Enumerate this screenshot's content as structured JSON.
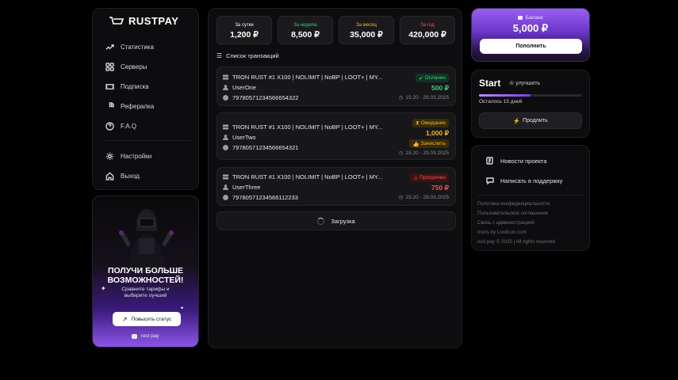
{
  "brand": {
    "name": "RUSTPAY"
  },
  "nav": {
    "items": [
      {
        "label": "Статистика"
      },
      {
        "label": "Серверы"
      },
      {
        "label": "Подписка"
      },
      {
        "label": "Рефералка"
      },
      {
        "label": "F.A.Q"
      }
    ],
    "bottom": [
      {
        "label": "Настройки"
      },
      {
        "label": "Выход"
      }
    ]
  },
  "promo": {
    "title_line1": "ПОЛУЧИ БОЛЬШЕ",
    "title_line2": "ВОЗМОЖНОСТЕЙ!",
    "sub_line1": "Сравните тарифы и",
    "sub_line2": "выберите лучший",
    "button": "Повысить статус",
    "footer": "rust pay"
  },
  "stats": [
    {
      "label": "За сутки",
      "value": "1,200 ₽",
      "color": "#ffffff"
    },
    {
      "label": "За неделю",
      "value": "8,500 ₽",
      "color": "#35d07f"
    },
    {
      "label": "За месяц",
      "value": "35,000 ₽",
      "color": "#f3b81a"
    },
    {
      "label": "За год",
      "value": "420,000 ₽",
      "color": "#ff4d4d"
    }
  ],
  "transactions_title": "Список транзакций",
  "transactions": [
    {
      "server": "TRON RUST #1 X100 | NOLIMIT | NoBP | LOOT+ | MY...",
      "user": "UserOne",
      "id": "79780571234566654322",
      "status": "Оплачен",
      "status_color": "#35d07f",
      "status_bg": "#143222",
      "amount": "500 ₽",
      "amount_color": "#35d07f",
      "extra": "",
      "date": "15:20 - 29.03.2025"
    },
    {
      "server": "TRON RUST #1 X100 | NOLIMIT | NoBP | LOOT+ | MY...",
      "user": "UserTwo",
      "id": "79780571234566654321",
      "status": "Ожидание",
      "status_color": "#f3b81a",
      "status_bg": "#3a2c08",
      "amount": "1,000 ₽",
      "amount_color": "#f3b81a",
      "extra": "Зачислить",
      "date": "15:20 - 29.03.2025"
    },
    {
      "server": "TRON RUST #1 X100 | NOLIMIT | NoBP | LOOT+ | MY...",
      "user": "UserThree",
      "id": "79780571234566112233",
      "status": "Просрочен",
      "status_color": "#ff4d4d",
      "status_bg": "#3a1414",
      "amount": "750 ₽",
      "amount_color": "#ff4d4d",
      "extra": "",
      "date": "15:20 - 29.03.2025"
    }
  ],
  "loading": "Загрузка",
  "balance": {
    "label": "Баланс",
    "value": "5,000 ₽",
    "button": "Пополнить"
  },
  "plan": {
    "name": "Start",
    "upgrade": "улучшить",
    "remaining": "Осталось 15 дней",
    "progress": 0.5,
    "renew": "Продлить"
  },
  "info": {
    "news": "Новости проекта",
    "support": "Написать в поддержку",
    "links": [
      "Политика конфиденциальности",
      "Пользовательское соглашение",
      "Связь с администрацией",
      "Icons by Lordicon.com",
      "rust pay © 2025 | All rights reserved"
    ]
  },
  "colors": {
    "accent": "#8b54e8",
    "panel": "#0d0d0f",
    "card": "#17171a"
  }
}
